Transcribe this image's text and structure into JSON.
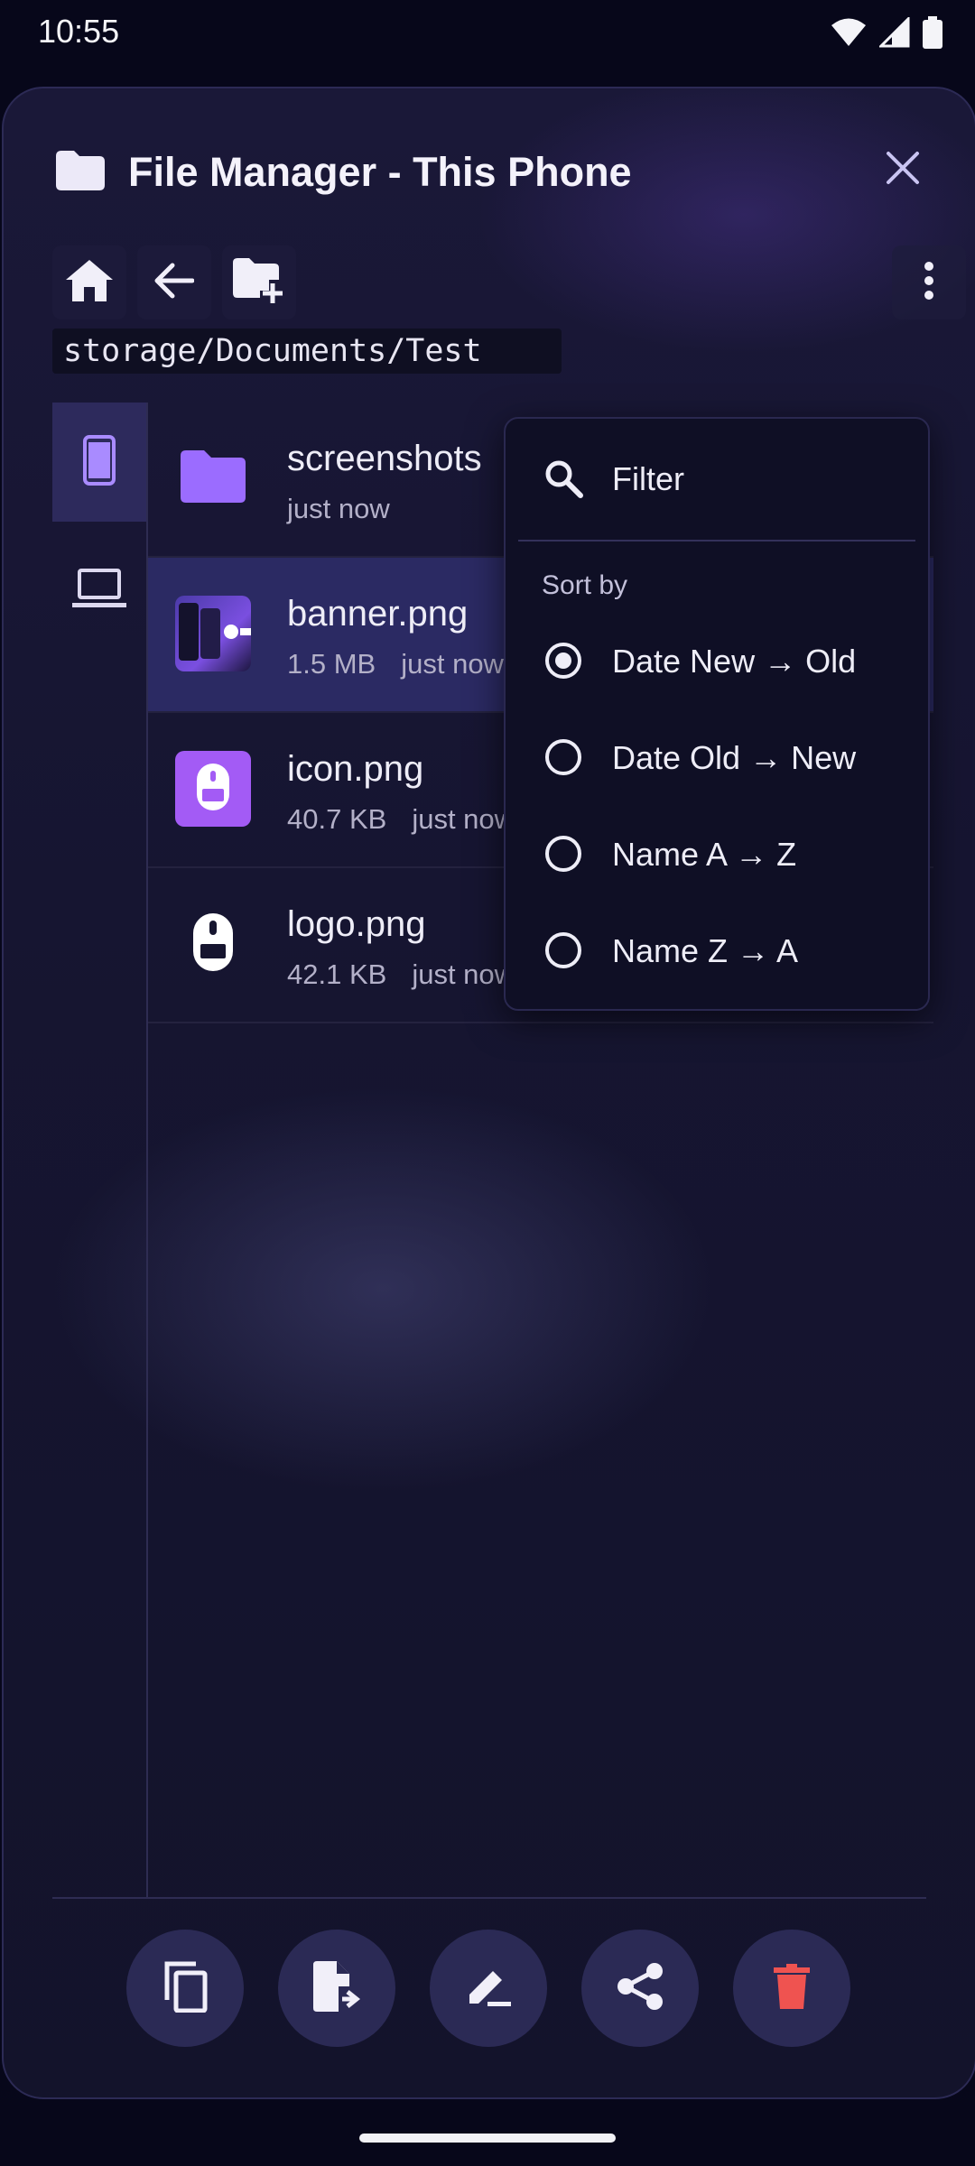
{
  "status_bar": {
    "time": "10:55",
    "icons": [
      "wifi-icon",
      "cell-signal-icon",
      "battery-icon"
    ]
  },
  "window": {
    "title": "File Manager - This Phone",
    "title_icon": "folder-icon",
    "close_icon": "close-icon"
  },
  "toolbar": {
    "buttons": [
      "home-icon",
      "back-arrow-icon",
      "new-folder-icon"
    ],
    "menu_icon": "more-vert-icon"
  },
  "path": "storage/Documents/Test",
  "side_rail": {
    "items": [
      {
        "name": "phone-icon",
        "active": true
      },
      {
        "name": "laptop-icon",
        "active": false
      }
    ]
  },
  "files": [
    {
      "name": "screenshots",
      "size": "",
      "time": "just now",
      "type": "folder"
    },
    {
      "name": "banner.png",
      "size": "1.5 MB",
      "time": "just now",
      "type": "image",
      "selected": true
    },
    {
      "name": "icon.png",
      "size": "40.7 KB",
      "time": "just now",
      "type": "image"
    },
    {
      "name": "logo.png",
      "size": "42.1 KB",
      "time": "just now",
      "type": "image"
    }
  ],
  "popup": {
    "filter_label": "Filter",
    "sort_heading": "Sort by",
    "options": [
      {
        "label": "Date New → Old",
        "checked": true
      },
      {
        "label": "Date Old → New",
        "checked": false
      },
      {
        "label": "Name A → Z",
        "checked": false
      },
      {
        "label": "Name Z → A",
        "checked": false
      }
    ]
  },
  "actions": [
    "copy-icon",
    "move-file-icon",
    "rename-icon",
    "share-icon",
    "delete-icon"
  ],
  "colors": {
    "accent": "#8b5cf6",
    "delete": "#ef5350",
    "background": "#13132b",
    "selected_row": "#2b2a63"
  }
}
